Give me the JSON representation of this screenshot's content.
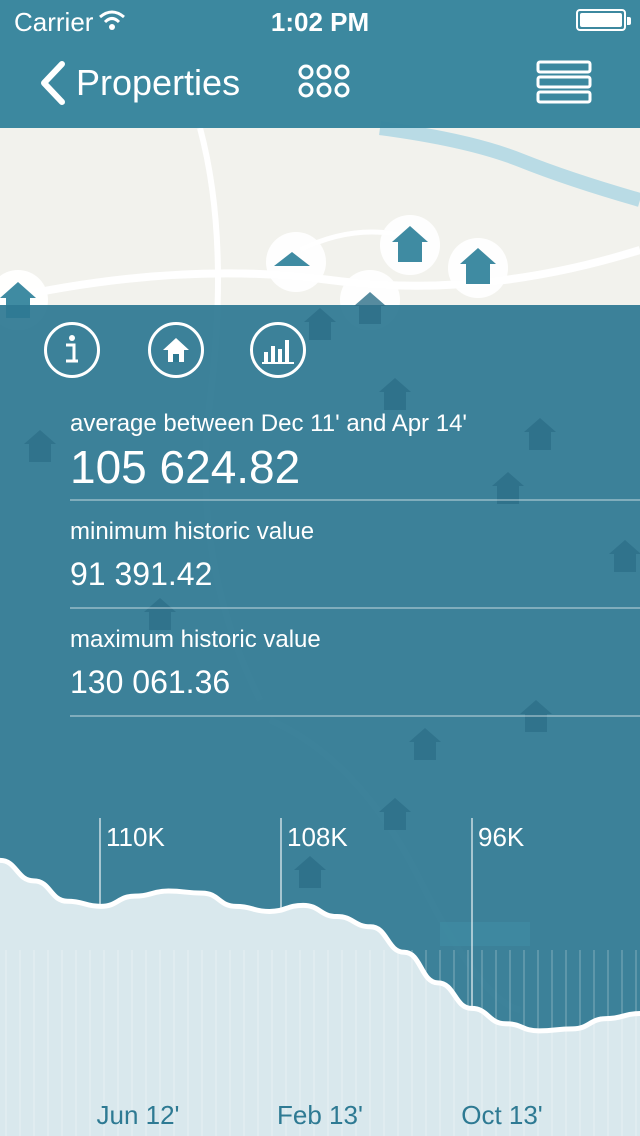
{
  "status_bar": {
    "carrier": "Carrier",
    "time": "1:02 PM"
  },
  "nav": {
    "back_label": "Properties",
    "grid_icon": "grid-icon",
    "menu_icon": "menu-icon"
  },
  "toolbar": {
    "icons": [
      "info-icon",
      "home-icon",
      "bar-chart-icon"
    ]
  },
  "stats": {
    "average": {
      "label": "average between Dec 11' and Apr 14'",
      "value": "105 624.82"
    },
    "minimum": {
      "label": "minimum historic value",
      "value": "91 391.42"
    },
    "maximum": {
      "label": "maximum historic value",
      "value": "130 061.36"
    }
  },
  "chart_data": {
    "type": "area",
    "title": "",
    "xlabel": "",
    "ylabel": "",
    "x_labels": [
      "Jun 12'",
      "Feb 13'",
      "Oct 13'"
    ],
    "markers": [
      {
        "label": "110K",
        "x": "Jun 12'"
      },
      {
        "label": "108K",
        "x": "Feb 13'"
      },
      {
        "label": "96K",
        "x": "Oct 13'"
      }
    ],
    "values": [
      113,
      111,
      109,
      108.5,
      109.5,
      110,
      109.8,
      108.5,
      108,
      108.6,
      107.5,
      106.5,
      104,
      101,
      98.5,
      97,
      96.3,
      96.5,
      97.5,
      98
    ],
    "ylim": [
      86,
      115
    ],
    "colors": {
      "fill": "#d9e8ed",
      "line": "#ffffff"
    }
  }
}
